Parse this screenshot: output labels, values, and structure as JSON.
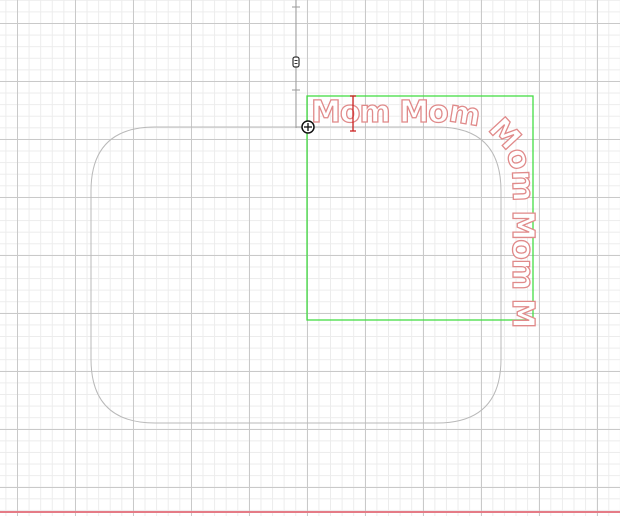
{
  "canvas": {
    "grid_major_color": "#c9c9c9",
    "grid_minor_color": "#ececec",
    "background": "#ffffff"
  },
  "mat": {
    "outline_color": "#b9b9b9",
    "shape": "rounded-rectangle"
  },
  "selection": {
    "box_color": "#44dd44",
    "handle_icon": "move-handle-icon",
    "rotate_icon": "rotate-handle-icon"
  },
  "text_path": {
    "text": "Mom Mom Mom Mom Mo",
    "stroke_color": "#e08a8a",
    "fill_color": "#ffffff",
    "cursor_color": "#cc2222"
  },
  "bottom_rule_color": "#e57b86"
}
